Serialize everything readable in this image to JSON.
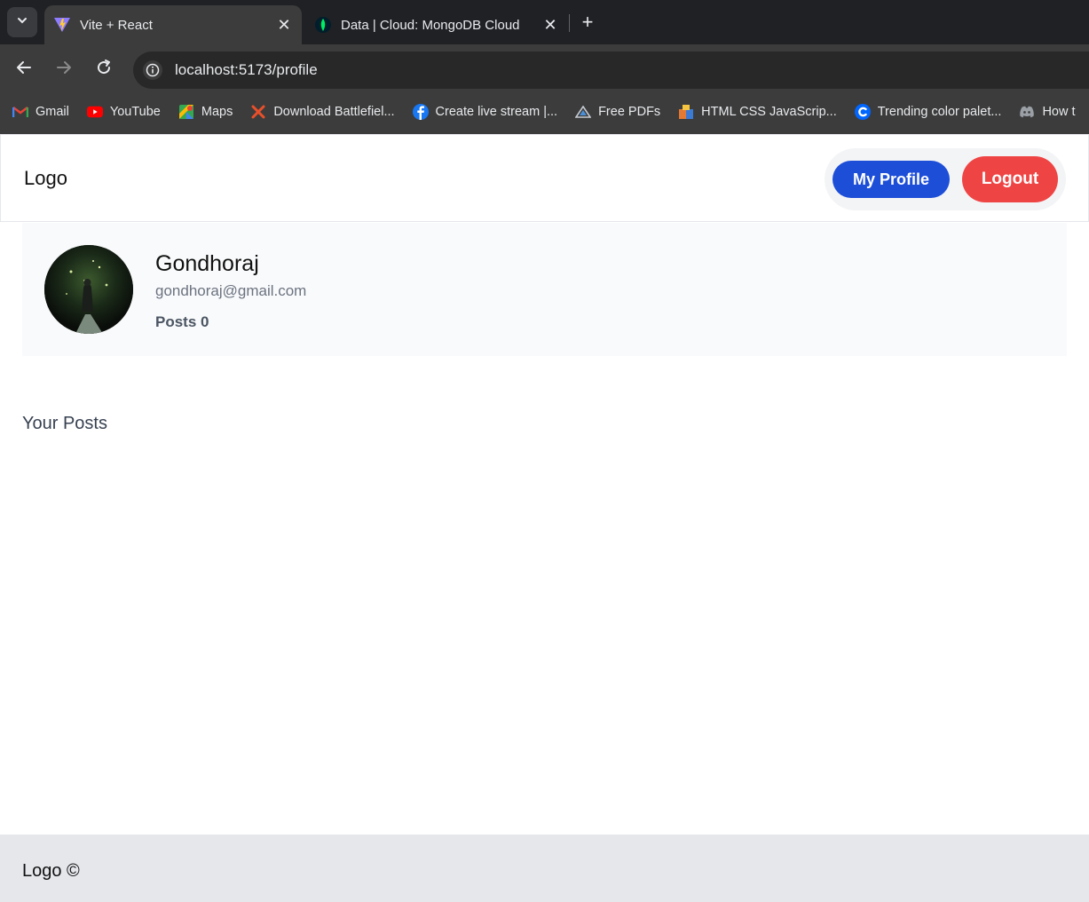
{
  "browser": {
    "tabs": [
      {
        "title": "Vite + React",
        "active": true,
        "icon": "vite-icon"
      },
      {
        "title": "Data | Cloud: MongoDB Cloud",
        "active": false,
        "icon": "mongodb-leaf-icon"
      }
    ],
    "address": "localhost:5173/profile",
    "bookmarks": [
      {
        "label": "Gmail",
        "icon": "gmail-icon",
        "color": "#ea4335"
      },
      {
        "label": "YouTube",
        "icon": "youtube-icon",
        "color": "#ff0000"
      },
      {
        "label": "Maps",
        "icon": "maps-icon",
        "color": "#34a853"
      },
      {
        "label": "Download Battlefiel...",
        "icon": "x-icon",
        "color": "#e8502b"
      },
      {
        "label": "Create live stream |...",
        "icon": "facebook-icon",
        "color": "#1877f2"
      },
      {
        "label": "Free PDFs",
        "icon": "triangle-icon",
        "color": "#9aa0a6"
      },
      {
        "label": "HTML CSS JavaScrip...",
        "icon": "blocks-icon",
        "color": "#e37933"
      },
      {
        "label": "Trending color palet...",
        "icon": "coolors-icon",
        "color": "#0066ff"
      },
      {
        "label": "How t",
        "icon": "discord-icon",
        "color": "#5865f2"
      }
    ]
  },
  "header": {
    "logo": "Logo",
    "profile_button": "My Profile",
    "logout_button": "Logout"
  },
  "profile": {
    "name": "Gondhoraj",
    "email": "gondhoraj@gmail.com",
    "posts": "Posts 0"
  },
  "posts_section": {
    "title": "Your Posts"
  },
  "footer": {
    "text": "Logo ©"
  },
  "colors": {
    "primary": "#1d4ed8",
    "danger": "#ef4444",
    "footer_bg": "#e5e7eb",
    "card_bg": "#f9fafb"
  }
}
